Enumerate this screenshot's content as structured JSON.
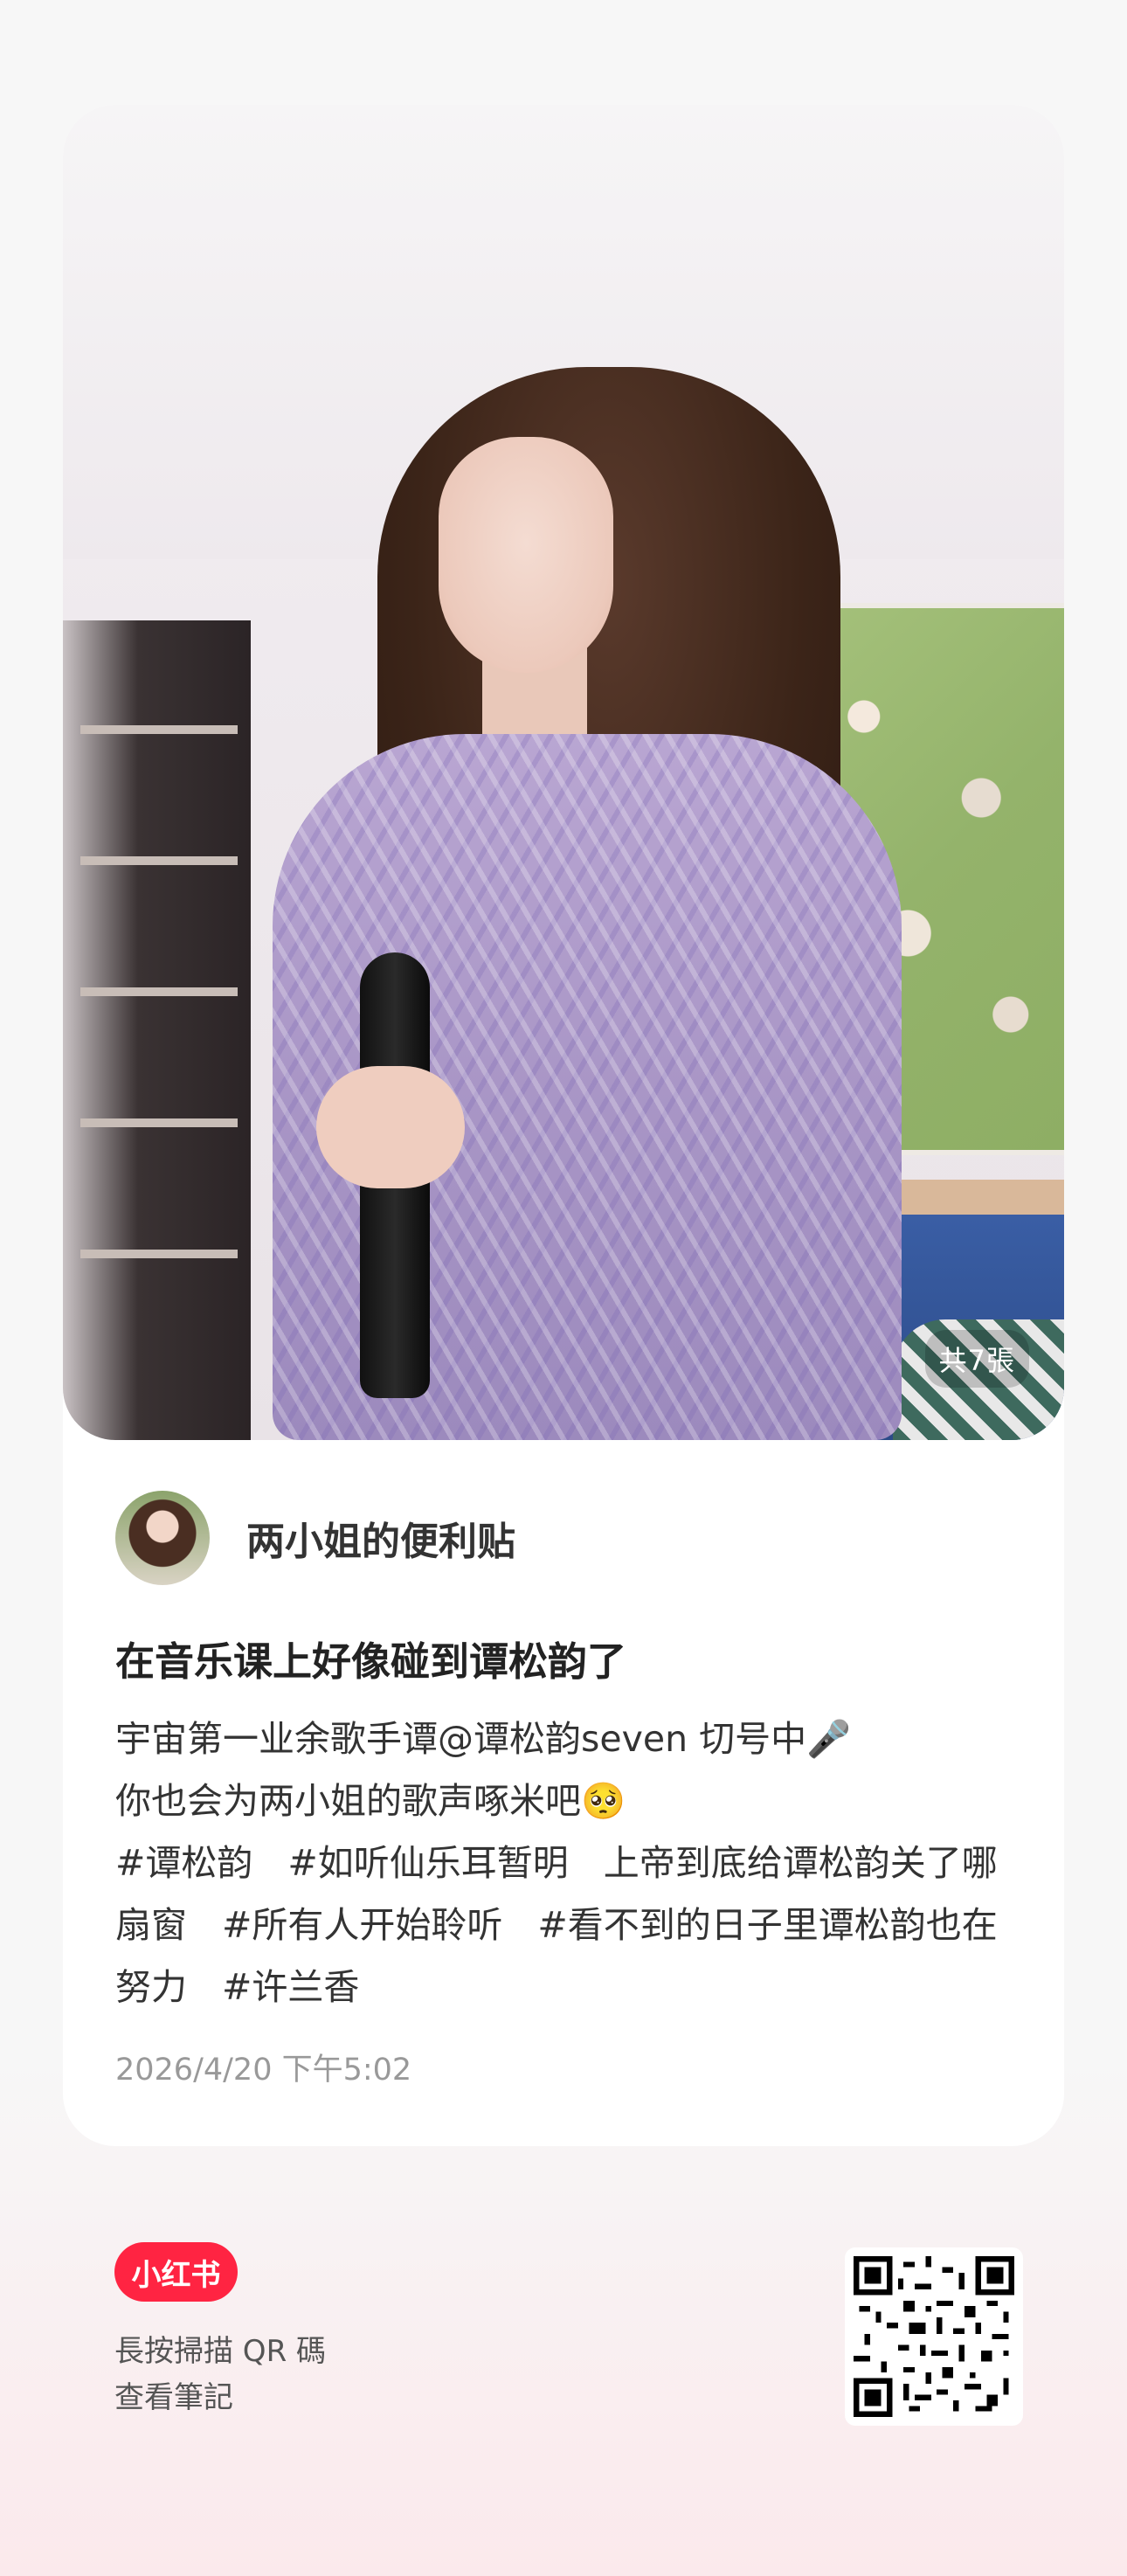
{
  "post": {
    "photo_count_label": "共7張",
    "author_name": "两小姐的便利贴",
    "title": "在音乐课上好像碰到谭松韵了",
    "desc_line1": "宇宙第一业余歌手谭@谭松韵seven 切号中🎤",
    "desc_line2": "你也会为两小姐的歌声啄米吧🥺",
    "tags_line3": [
      "#谭松韵",
      "#如听仙乐耳暂明",
      "上帝到底给谭松韵关了哪"
    ],
    "tags_line4": [
      "扇窗",
      "#所有人开始聆听",
      "#看不到的日子里谭松韵也在"
    ],
    "tags_line5": [
      "努力",
      "#许兰香"
    ],
    "timestamp": "2026/4/20 下午5:02"
  },
  "footer": {
    "brand": "小红书",
    "scan_line1": "長按掃描 QR 碼",
    "scan_line2": "查看筆記"
  },
  "colors": {
    "brand_red": "#ff2442",
    "timestamp_gray": "#999999"
  }
}
